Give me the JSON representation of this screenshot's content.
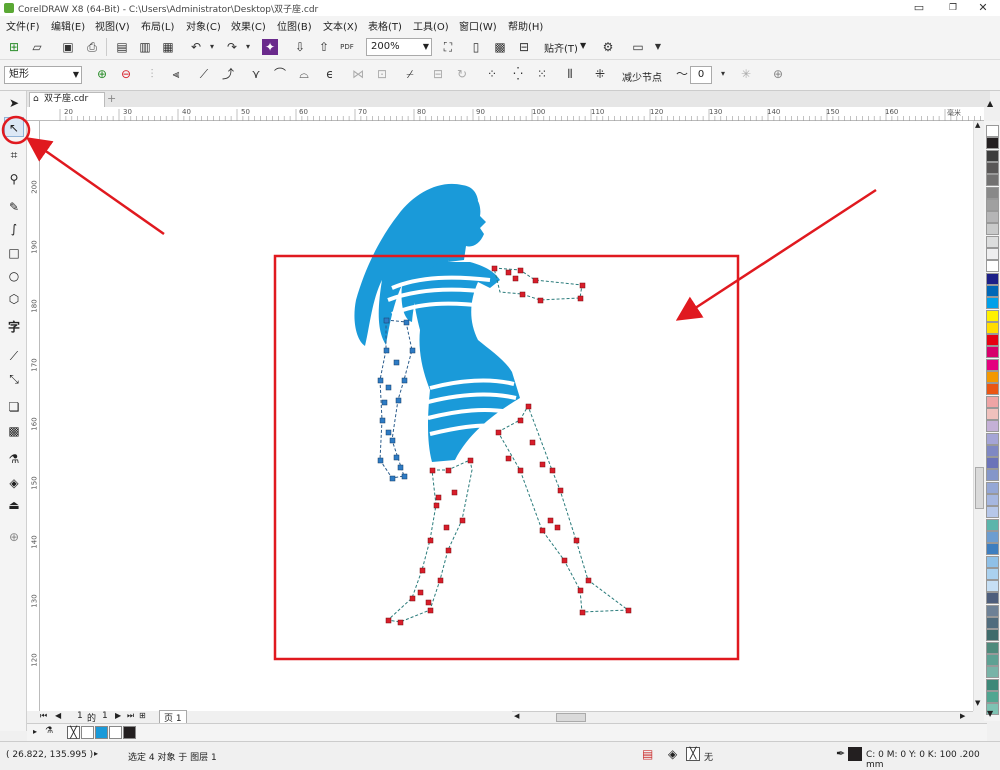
{
  "window": {
    "title": "CorelDRAW X8 (64-Bit) - C:\\Users\\Administrator\\Desktop\\双子座.cdr"
  },
  "menu": [
    "文件(F)",
    "编辑(E)",
    "视图(V)",
    "布局(L)",
    "对象(C)",
    "效果(C)",
    "位图(B)",
    "文本(X)",
    "表格(T)",
    "工具(O)",
    "窗口(W)",
    "帮助(H)"
  ],
  "standard_toolbar": {
    "zoom": "200%",
    "snap_label": "贴齐(T)",
    "pdf_label": "PDF"
  },
  "property_bar": {
    "object_type": "矩形",
    "reduce_nodes_label": "减少节点",
    "smoothness_value": "0"
  },
  "doc_tab": {
    "name": "双子座.cdr"
  },
  "hruler_labels": [
    "20",
    "30",
    "40",
    "50",
    "60",
    "70",
    "80",
    "90",
    "100",
    "110",
    "120",
    "130",
    "140",
    "150",
    "160"
  ],
  "hruler_unit": "毫米",
  "vruler_labels": [
    "200",
    "190",
    "180",
    "170",
    "160",
    "150",
    "140",
    "130",
    "120"
  ],
  "page_nav": {
    "current": "1",
    "of_label": "的",
    "total": "1",
    "page_tab": "页 1"
  },
  "status": {
    "coords": "( 26.822, 135.995 )",
    "selection": "选定 4 对象 于 图层 1",
    "fill_none": "无",
    "outline": "C: 0 M: 0 Y: 0 K: 100  .200 mm"
  },
  "colors": {
    "figure": "#1a9ad9",
    "annotation": "#e0191f",
    "node_red": "#d81e2a",
    "node_blue": "#2e7bc4"
  },
  "palette_colors": [
    "#ffffff",
    "#231f20",
    "#3d3d3d",
    "#595757",
    "#727171",
    "#898989",
    "#a0a0a0",
    "#b5b5b6",
    "#c9caca",
    "#dcdddd",
    "#eeeeef",
    "#ffffff",
    "#1d2088",
    "#0068b7",
    "#00a0e9",
    "#fff100",
    "#ffdd00",
    "#e60012",
    "#d7006c",
    "#e4007f",
    "#f39800",
    "#ea5514",
    "#eea4a5",
    "#f0c1bd",
    "#c4b0d6",
    "#a5a5d6",
    "#7f88c3",
    "#6b73b9",
    "#8496c9",
    "#95a7d5",
    "#a6b7e0",
    "#b6c7e9",
    "#5bb5ab",
    "#6d9dd0",
    "#3e7ebf",
    "#8fc0e7",
    "#aad1ef",
    "#c6dff4",
    "#4e5e7c",
    "#6e8196",
    "#506c7d",
    "#3e6b6b",
    "#4f8a7c",
    "#5ea193",
    "#78b3a7",
    "#3d8878",
    "#51a691",
    "#7ec3b3"
  ],
  "document_palette": [
    "#ffffff",
    "#1a9ad9",
    "#ffffff",
    "#231f20"
  ]
}
